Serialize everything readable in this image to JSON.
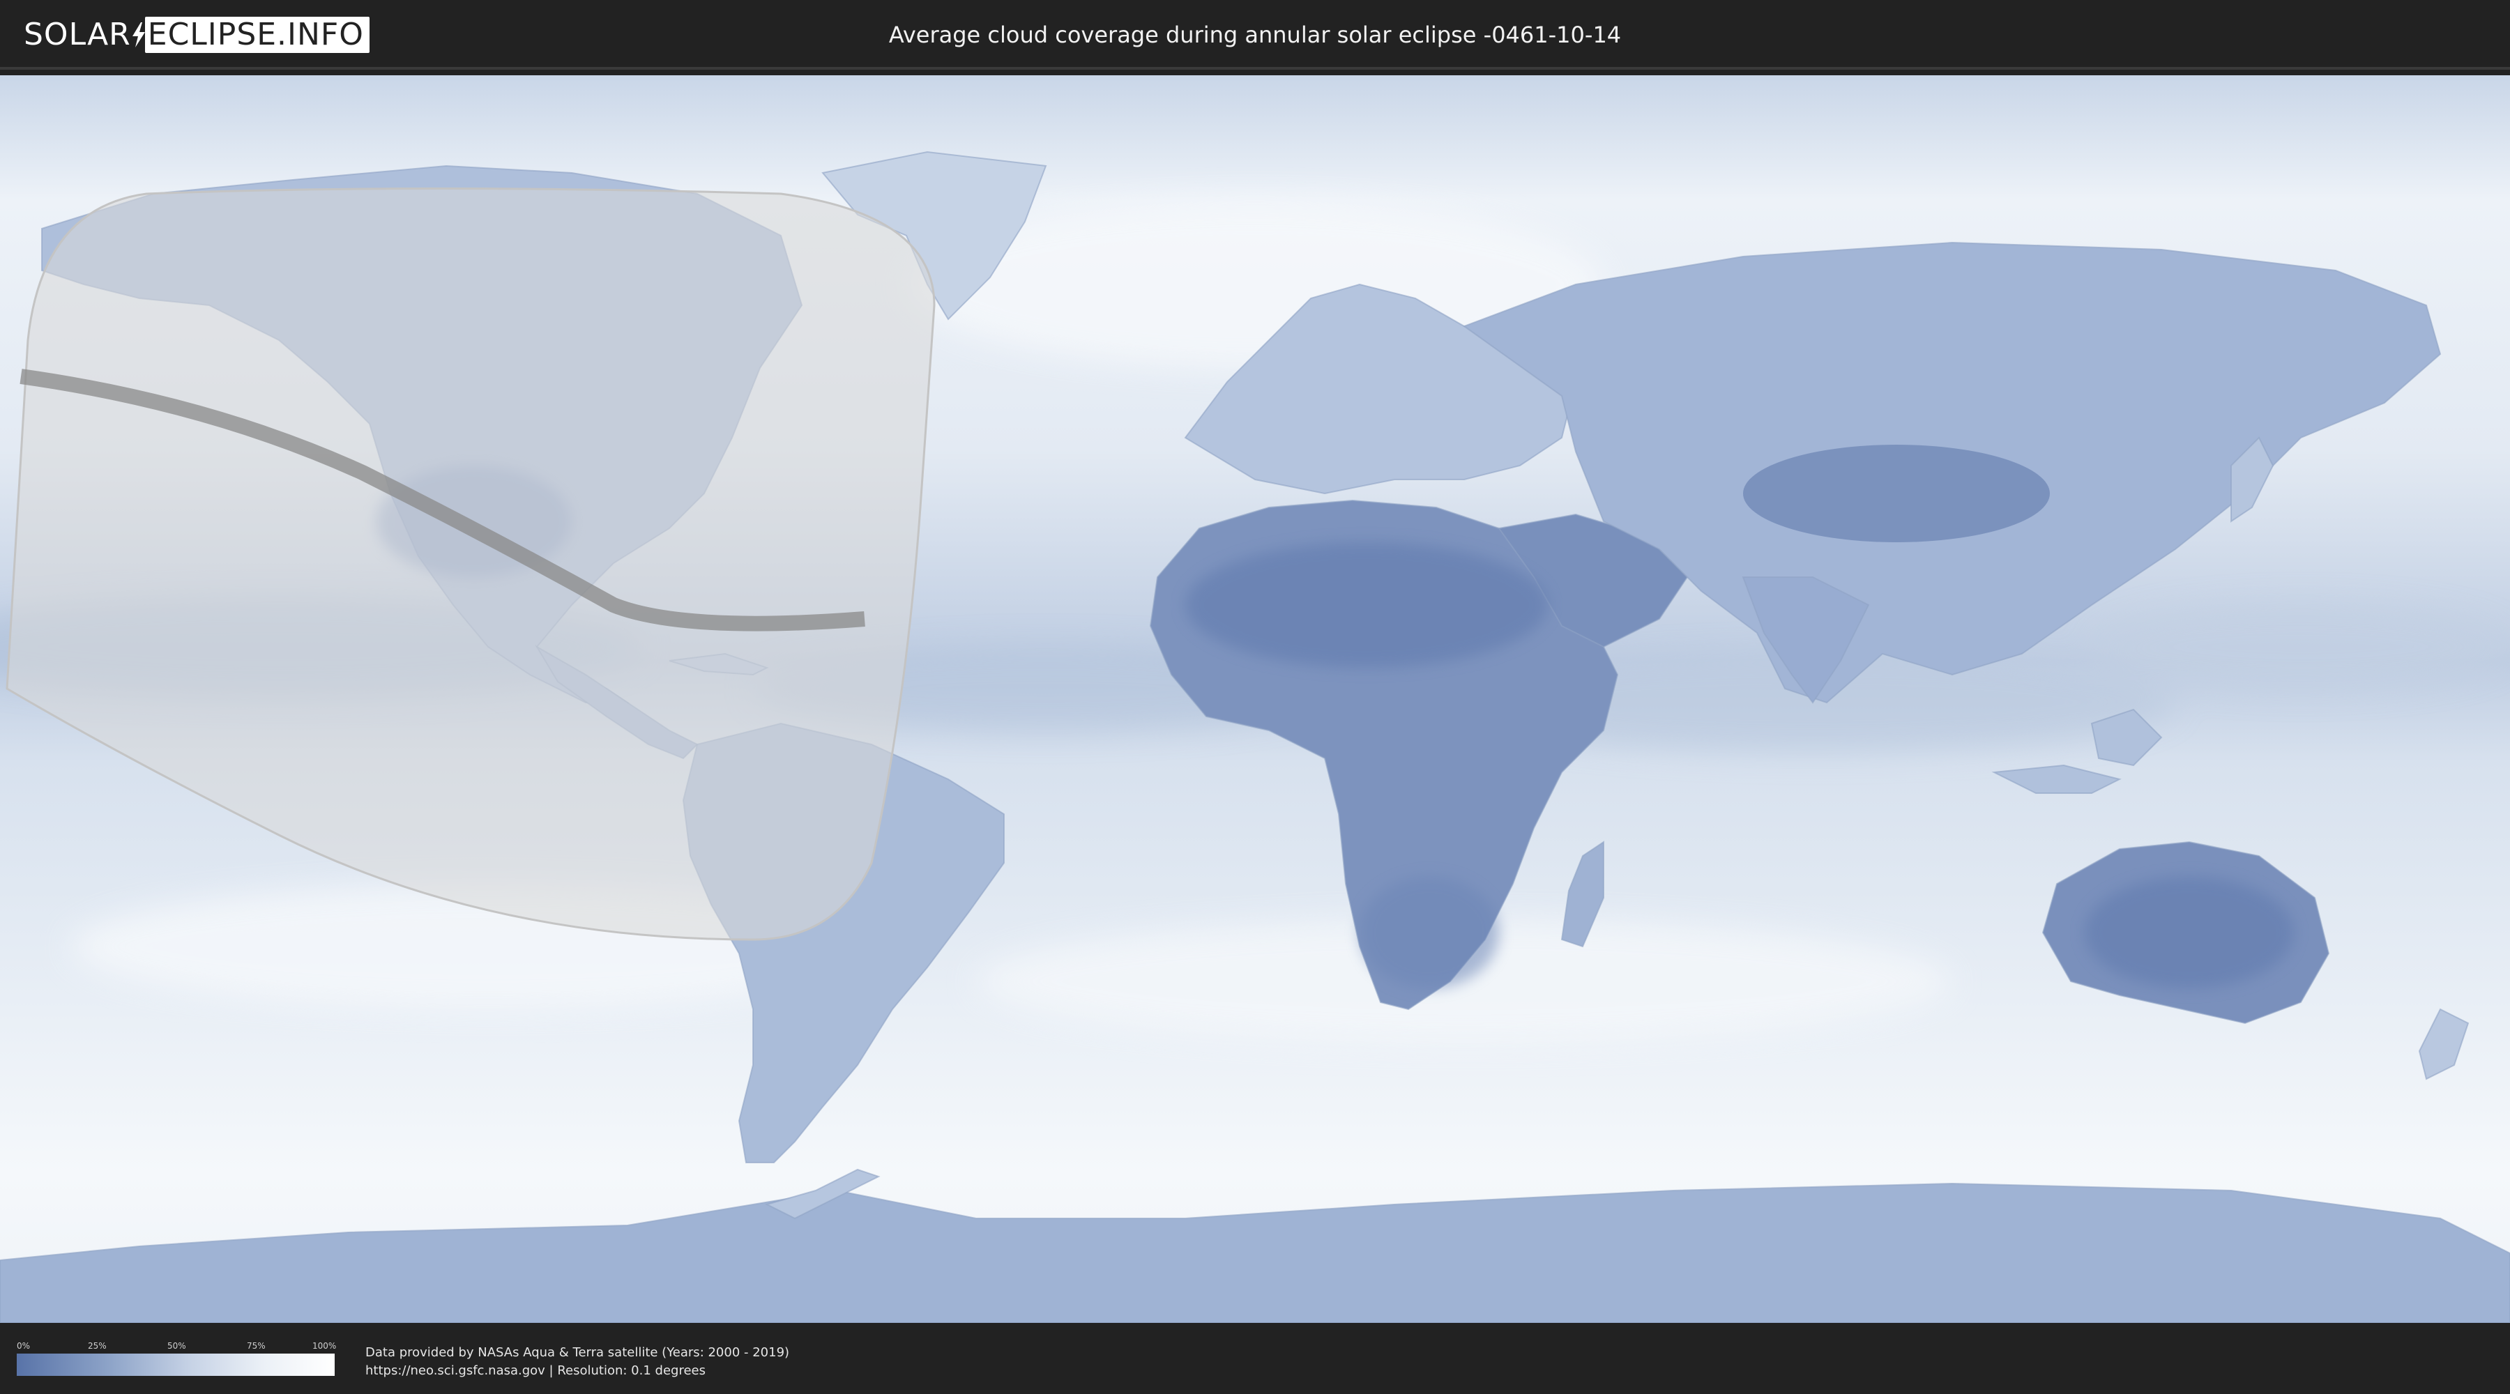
{
  "header": {
    "logo_part1": "SOLAR",
    "logo_part2": "ECLIPSE.INFO",
    "title": "Average cloud coverage during annular solar eclipse -0461-10-14"
  },
  "legend": {
    "ticks": [
      "0%",
      "25%",
      "50%",
      "75%",
      "100%"
    ],
    "color_low": "#5873a8",
    "color_high": "#ffffff"
  },
  "footer": {
    "credit_line1": "Data provided by NASAs Aqua & Terra satellite (Years: 2000 - 2019)",
    "credit_line2": "https://neo.sci.gsfc.nasa.gov | Resolution: 0.1 degrees"
  },
  "map": {
    "projection": "equirectangular",
    "ocean_color": "#dfe7f1",
    "land_dark_color": "#6f86b5",
    "eclipse_zone_color": "#d9d9d9",
    "eclipse_path_color": "#8a8a8a"
  }
}
